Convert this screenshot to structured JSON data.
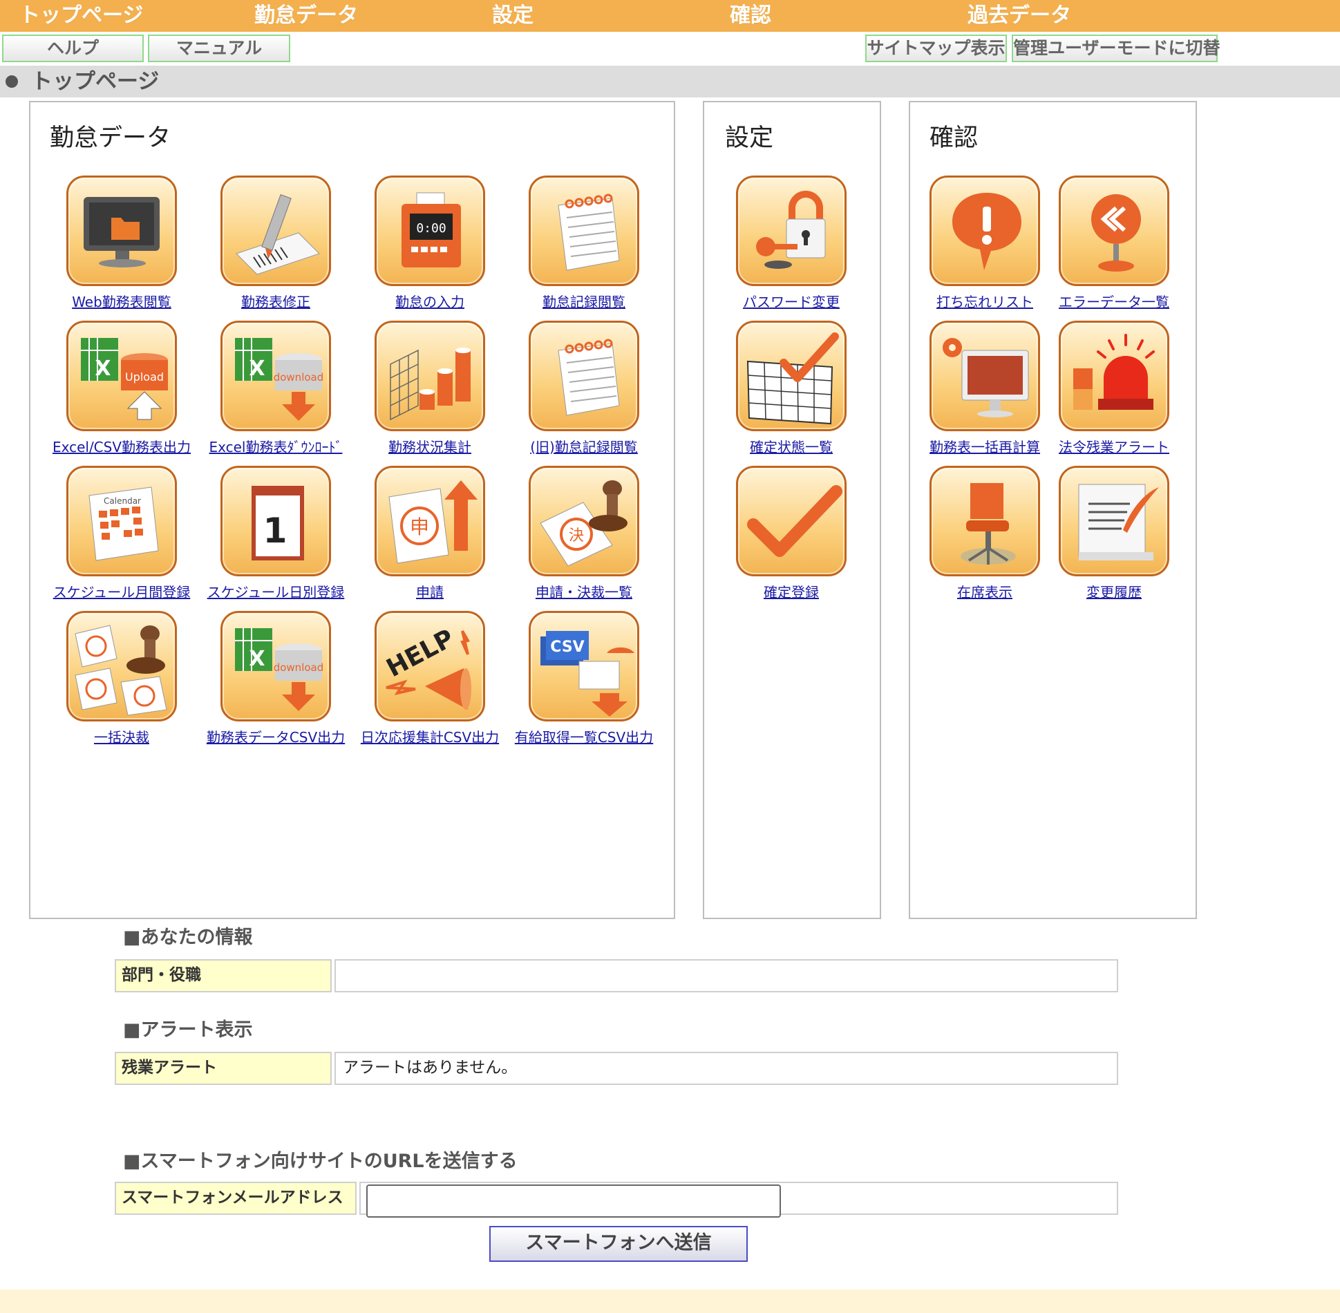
{
  "nav": {
    "items": [
      "トップページ",
      "勤怠データ",
      "設定",
      "確認",
      "過去データ"
    ]
  },
  "toolbar": {
    "help_label": "ヘルプ",
    "manual_label": "マニュアル",
    "sitemap_label": "サイトマップ表示",
    "admin_mode_label": "管理ユーザーモードに切替"
  },
  "page": {
    "title": "トップページ"
  },
  "panels": {
    "attendance": {
      "heading": "勤怠データ",
      "items": [
        {
          "label": "Web勤務表閲覧",
          "icon": "monitor-folder-icon"
        },
        {
          "label": "勤務表修正",
          "icon": "barcode-pen-icon"
        },
        {
          "label": "勤怠の入力",
          "icon": "time-recorder-icon"
        },
        {
          "label": "勤怠記録閲覧",
          "icon": "notepad-icon"
        },
        {
          "label": "Excel/CSV勤務表出力",
          "icon": "excel-upload-icon"
        },
        {
          "label": "Excel勤務表ﾀﾞｳﾝﾛｰﾄﾞ",
          "icon": "excel-download-icon"
        },
        {
          "label": "勤務状況集計",
          "icon": "bar-chart-3d-icon"
        },
        {
          "label": "(旧)勤怠記録閲覧",
          "icon": "notepad-icon"
        },
        {
          "label": "スケジュール月間登録",
          "icon": "monthly-calendar-icon"
        },
        {
          "label": "スケジュール日別登録",
          "icon": "daily-calendar-icon"
        },
        {
          "label": "申請",
          "icon": "application-document-icon"
        },
        {
          "label": "申請・決裁一覧",
          "icon": "approval-stamp-icon"
        },
        {
          "label": "一括決裁",
          "icon": "bulk-approval-stamp-icon"
        },
        {
          "label": "勤務表データCSV出力",
          "icon": "excel-download-icon"
        },
        {
          "label": "日次応援集計CSV出力",
          "icon": "help-megaphone-icon"
        },
        {
          "label": "有給取得一覧CSV出力",
          "icon": "csv-vacation-icon"
        }
      ],
      "icon_badges": {
        "upload": "Upload",
        "download": "download",
        "excel": "X",
        "clock": "0:00",
        "calendar": "Calendar",
        "day": "1",
        "shin": "申",
        "kessai": "決",
        "help": "HELP",
        "csv": "CSV"
      }
    },
    "settings": {
      "heading": "設定",
      "items": [
        {
          "label": "パスワード変更",
          "icon": "lock-key-icon"
        },
        {
          "label": "確定状態一覧",
          "icon": "grid-check-icon"
        },
        {
          "label": "確定登録",
          "icon": "checkmark-icon"
        }
      ]
    },
    "confirm": {
      "heading": "確認",
      "items": [
        {
          "label": "打ち忘れリスト",
          "icon": "alert-bubble-icon"
        },
        {
          "label": "エラーデータ一覧",
          "icon": "error-sign-icon"
        },
        {
          "label": "勤務表一括再計算",
          "icon": "gear-monitor-icon"
        },
        {
          "label": "法令残業アラート",
          "icon": "siren-icon"
        },
        {
          "label": "在席表示",
          "icon": "office-chair-icon"
        },
        {
          "label": "変更履歴",
          "icon": "scroll-quill-icon"
        }
      ]
    }
  },
  "info": {
    "your_info_heading": "■あなたの情報",
    "dept_label": "部門・役職",
    "dept_value": "",
    "alert_heading": "■アラート表示",
    "overtime_label": "残業アラート",
    "overtime_value": "アラートはありません。",
    "smartphone_heading": "■スマートフォン向けサイトのURLを送信する",
    "email_label": "スマートフォンメールアドレス",
    "email_value": "",
    "email_placeholder": "",
    "send_label": "スマートフォンへ送信"
  },
  "colors": {
    "nav_bg": "#f4b04e",
    "icon_border": "#c2651b",
    "icon_orange": "#e8642a",
    "link": "#1a1aa6",
    "label_bg": "#ffffcc"
  }
}
